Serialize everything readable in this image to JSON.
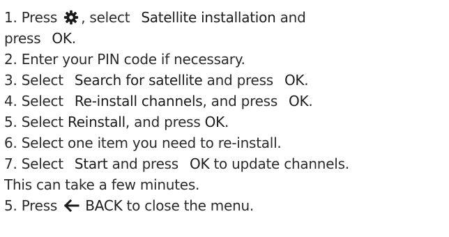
{
  "colors": {
    "text": "#2a2a2a",
    "icon": "#1a1a1a"
  },
  "icons": {
    "settings": "gear-icon",
    "back": "back-arrow-icon"
  },
  "steps": [
    {
      "prefix": "1. Press",
      "mid1": ", select",
      "bold": "Satellite installation",
      "suffix": "and"
    },
    {
      "prefix": "press",
      "bold": "OK",
      "suffix": "."
    },
    {
      "text": "2. Enter your PIN code if necessary."
    },
    {
      "prefix": "3. Select",
      "bold": "Search for satellite",
      "mid": "and press",
      "bold2": "OK",
      "suffix": "."
    },
    {
      "prefix": "4. Select",
      "bold": "Re-install channels",
      "mid": ", and press",
      "bold2": "OK",
      "suffix": "."
    },
    {
      "prefix": "5. Select",
      "bold": "Reinstall",
      "mid": ", and press",
      "bold2": "OK",
      "suffix": "."
    },
    {
      "text": "6. Select one item you need to re-install."
    },
    {
      "prefix": "7. Select",
      "bold": "Start",
      "mid": "and press",
      "bold2": "OK",
      "suffix": "to update channels."
    },
    {
      "text": "This can take a few minutes."
    },
    {
      "prefix": "5. Press",
      "bold": "BACK",
      "suffix": "to close the menu."
    }
  ]
}
